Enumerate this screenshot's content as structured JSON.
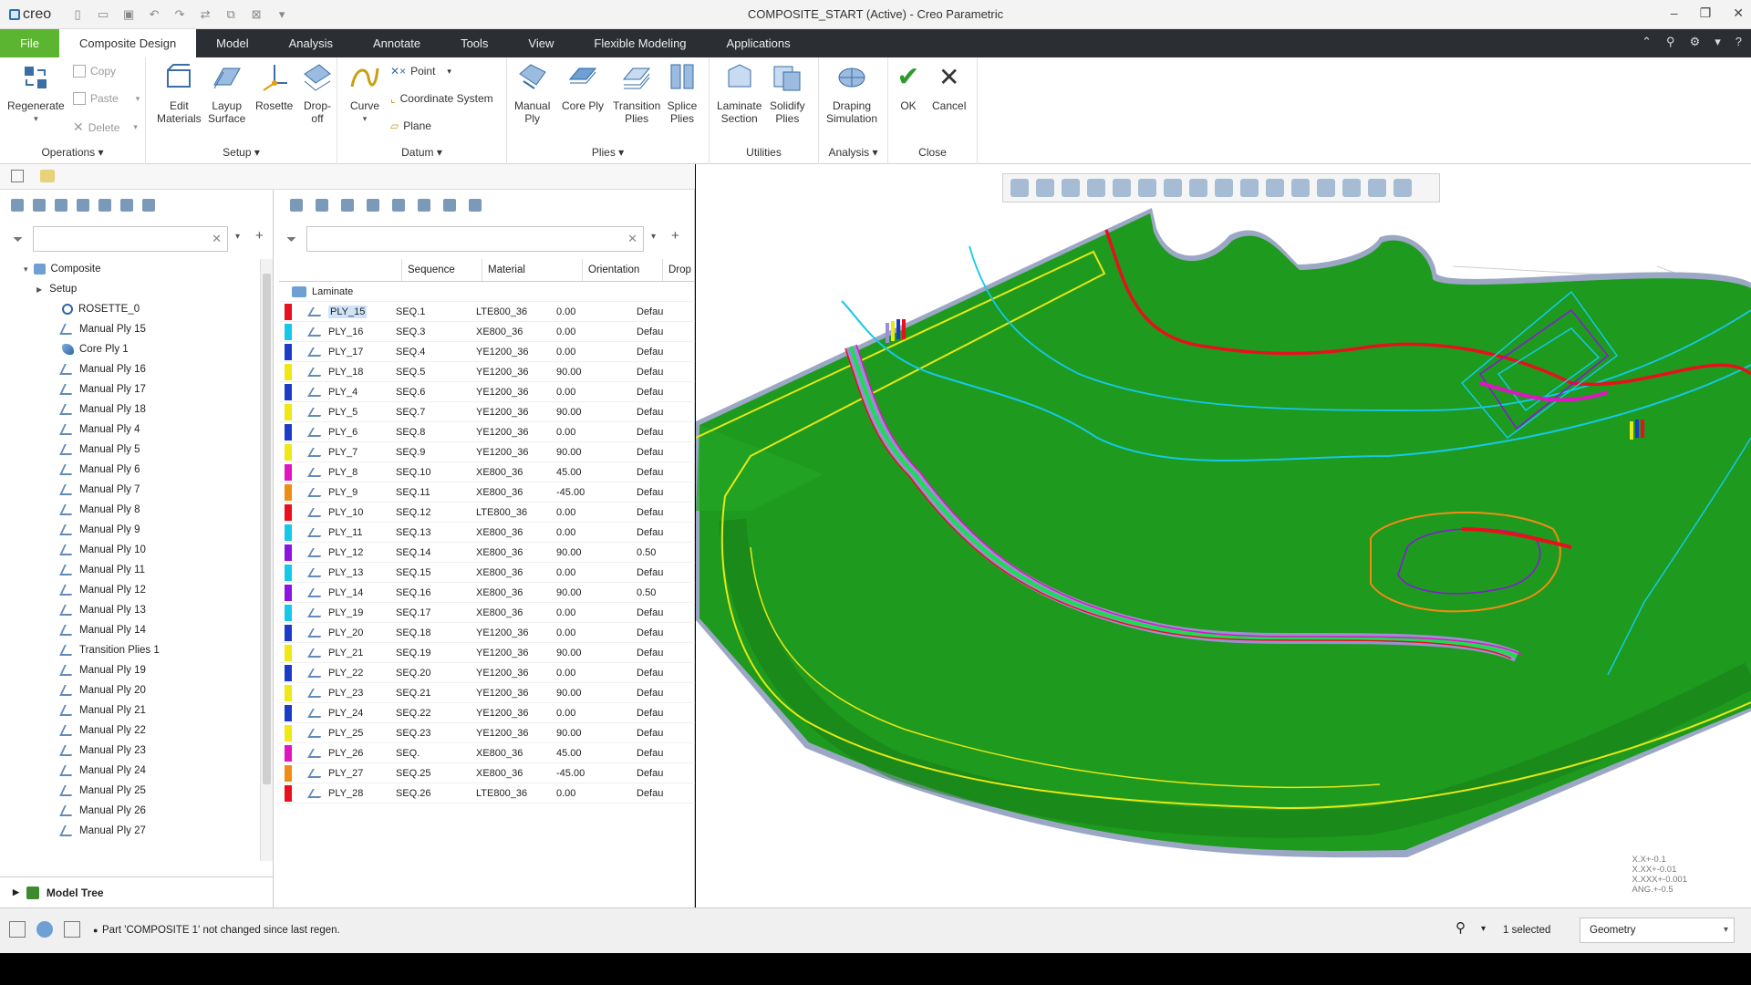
{
  "window": {
    "logo": "creo",
    "title": "COMPOSITE_START (Active) - Creo Parametric"
  },
  "ribbon_tabs": [
    "File",
    "Composite Design",
    "Model",
    "Analysis",
    "Annotate",
    "Tools",
    "View",
    "Flexible Modeling",
    "Applications"
  ],
  "groups": {
    "operations": {
      "label": "Operations",
      "regenerate": "Regenerate",
      "copy": "Copy",
      "paste": "Paste",
      "delete": "Delete"
    },
    "setup": {
      "label": "Setup",
      "edit_materials": "Edit\nMaterials",
      "layup_surface": "Layup\nSurface",
      "rosette": "Rosette",
      "dropoff": "Drop-\noff"
    },
    "datum": {
      "label": "Datum",
      "curve": "Curve",
      "point": "Point",
      "coordinate_system": "Coordinate System",
      "plane": "Plane"
    },
    "plies": {
      "label": "Plies",
      "manual_ply": "Manual\nPly",
      "core_ply": "Core Ply",
      "transition_plies": "Transition\nPlies",
      "splice_plies": "Splice\nPlies"
    },
    "utilities": {
      "label": "Utilities",
      "laminate_section": "Laminate\nSection",
      "solidify_plies": "Solidify\nPlies"
    },
    "analysis": {
      "label": "Analysis",
      "draping_simulation": "Draping\nSimulation"
    },
    "close": {
      "label": "Close",
      "ok": "OK",
      "cancel": "Cancel"
    }
  },
  "tree": {
    "items": [
      {
        "label": "Composite",
        "type": "comp",
        "indent": 0
      },
      {
        "label": "Setup",
        "type": "none",
        "indent": 1
      },
      {
        "label": "ROSETTE_0",
        "type": "ros",
        "indent": 2
      },
      {
        "label": "Manual Ply 15",
        "type": "ply",
        "indent": 2
      },
      {
        "label": "Core Ply 1",
        "type": "core",
        "indent": 2
      },
      {
        "label": "Manual Ply 16",
        "type": "ply",
        "indent": 2
      },
      {
        "label": "Manual Ply 17",
        "type": "ply",
        "indent": 2
      },
      {
        "label": "Manual Ply 18",
        "type": "ply",
        "indent": 2
      },
      {
        "label": "Manual Ply 4",
        "type": "ply",
        "indent": 2
      },
      {
        "label": "Manual Ply 5",
        "type": "ply",
        "indent": 2
      },
      {
        "label": "Manual Ply 6",
        "type": "ply",
        "indent": 2
      },
      {
        "label": "Manual Ply 7",
        "type": "ply",
        "indent": 2
      },
      {
        "label": "Manual Ply 8",
        "type": "ply",
        "indent": 2
      },
      {
        "label": "Manual Ply 9",
        "type": "ply",
        "indent": 2
      },
      {
        "label": "Manual Ply 10",
        "type": "ply",
        "indent": 2
      },
      {
        "label": "Manual Ply 11",
        "type": "ply",
        "indent": 2
      },
      {
        "label": "Manual Ply 12",
        "type": "ply",
        "indent": 2
      },
      {
        "label": "Manual Ply 13",
        "type": "ply",
        "indent": 2
      },
      {
        "label": "Manual Ply 14",
        "type": "ply",
        "indent": 2
      },
      {
        "label": "Transition Plies 1",
        "type": "ply",
        "indent": 2
      },
      {
        "label": "Manual Ply 19",
        "type": "ply",
        "indent": 2
      },
      {
        "label": "Manual Ply 20",
        "type": "ply",
        "indent": 2
      },
      {
        "label": "Manual Ply 21",
        "type": "ply",
        "indent": 2
      },
      {
        "label": "Manual Ply 22",
        "type": "ply",
        "indent": 2
      },
      {
        "label": "Manual Ply 23",
        "type": "ply",
        "indent": 2
      },
      {
        "label": "Manual Ply 24",
        "type": "ply",
        "indent": 2
      },
      {
        "label": "Manual Ply 25",
        "type": "ply",
        "indent": 2
      },
      {
        "label": "Manual Ply 26",
        "type": "ply",
        "indent": 2
      },
      {
        "label": "Manual Ply 27",
        "type": "ply",
        "indent": 2
      }
    ],
    "model_tree_label": "Model Tree"
  },
  "table": {
    "root_label": "Laminate",
    "columns": [
      "Sequence",
      "Material",
      "Orientation",
      "Drop"
    ],
    "rows": [
      {
        "ply": "PLY_15",
        "seq": "SEQ.1",
        "mat": "LTE800_36",
        "ori": "0.00",
        "drop": "Defau",
        "color": "#e8101c"
      },
      {
        "ply": "PLY_16",
        "seq": "SEQ.3",
        "mat": "XE800_36",
        "ori": "0.00",
        "drop": "Defau",
        "color": "#16c8e8"
      },
      {
        "ply": "PLY_17",
        "seq": "SEQ.4",
        "mat": "YE1200_36",
        "ori": "0.00",
        "drop": "Defau",
        "color": "#1c3cc8"
      },
      {
        "ply": "PLY_18",
        "seq": "SEQ.5",
        "mat": "YE1200_36",
        "ori": "90.00",
        "drop": "Defau",
        "color": "#f0e814"
      },
      {
        "ply": "PLY_4",
        "seq": "SEQ.6",
        "mat": "YE1200_36",
        "ori": "0.00",
        "drop": "Defau",
        "color": "#1c3cc8"
      },
      {
        "ply": "PLY_5",
        "seq": "SEQ.7",
        "mat": "YE1200_36",
        "ori": "90.00",
        "drop": "Defau",
        "color": "#f0e814"
      },
      {
        "ply": "PLY_6",
        "seq": "SEQ.8",
        "mat": "YE1200_36",
        "ori": "0.00",
        "drop": "Defau",
        "color": "#1c3cc8"
      },
      {
        "ply": "PLY_7",
        "seq": "SEQ.9",
        "mat": "YE1200_36",
        "ori": "90.00",
        "drop": "Defau",
        "color": "#f0e814"
      },
      {
        "ply": "PLY_8",
        "seq": "SEQ.10",
        "mat": "XE800_36",
        "ori": "45.00",
        "drop": "Defau",
        "color": "#e014c0"
      },
      {
        "ply": "PLY_9",
        "seq": "SEQ.11",
        "mat": "XE800_36",
        "ori": "-45.00",
        "drop": "Defau",
        "color": "#f08c14"
      },
      {
        "ply": "PLY_10",
        "seq": "SEQ.12",
        "mat": "LTE800_36",
        "ori": "0.00",
        "drop": "Defau",
        "color": "#e8101c"
      },
      {
        "ply": "PLY_11",
        "seq": "SEQ.13",
        "mat": "XE800_36",
        "ori": "0.00",
        "drop": "Defau",
        "color": "#16c8e8"
      },
      {
        "ply": "PLY_12",
        "seq": "SEQ.14",
        "mat": "XE800_36",
        "ori": "90.00",
        "drop": "0.50",
        "color": "#8c14e0"
      },
      {
        "ply": "PLY_13",
        "seq": "SEQ.15",
        "mat": "XE800_36",
        "ori": "0.00",
        "drop": "Defau",
        "color": "#16c8e8"
      },
      {
        "ply": "PLY_14",
        "seq": "SEQ.16",
        "mat": "XE800_36",
        "ori": "90.00",
        "drop": "0.50",
        "color": "#8c14e0"
      },
      {
        "ply": "PLY_19",
        "seq": "SEQ.17",
        "mat": "XE800_36",
        "ori": "0.00",
        "drop": "Defau",
        "color": "#16c8e8"
      },
      {
        "ply": "PLY_20",
        "seq": "SEQ.18",
        "mat": "YE1200_36",
        "ori": "0.00",
        "drop": "Defau",
        "color": "#1c3cc8"
      },
      {
        "ply": "PLY_21",
        "seq": "SEQ.19",
        "mat": "YE1200_36",
        "ori": "90.00",
        "drop": "Defau",
        "color": "#f0e814"
      },
      {
        "ply": "PLY_22",
        "seq": "SEQ.20",
        "mat": "YE1200_36",
        "ori": "0.00",
        "drop": "Defau",
        "color": "#1c3cc8"
      },
      {
        "ply": "PLY_23",
        "seq": "SEQ.21",
        "mat": "YE1200_36",
        "ori": "90.00",
        "drop": "Defau",
        "color": "#f0e814"
      },
      {
        "ply": "PLY_24",
        "seq": "SEQ.22",
        "mat": "YE1200_36",
        "ori": "0.00",
        "drop": "Defau",
        "color": "#1c3cc8"
      },
      {
        "ply": "PLY_25",
        "seq": "SEQ.23",
        "mat": "YE1200_36",
        "ori": "90.00",
        "drop": "Defau",
        "color": "#f0e814"
      },
      {
        "ply": "PLY_26",
        "seq": "SEQ.",
        "mat": "XE800_36",
        "ori": "45.00",
        "drop": "Defau",
        "color": "#e014c0"
      },
      {
        "ply": "PLY_27",
        "seq": "SEQ.25",
        "mat": "XE800_36",
        "ori": "-45.00",
        "drop": "Defau",
        "color": "#f08c14"
      },
      {
        "ply": "PLY_28",
        "seq": "SEQ.26",
        "mat": "LTE800_36",
        "ori": "0.00",
        "drop": "Defau",
        "color": "#e8101c"
      }
    ]
  },
  "viewport": {
    "tolerances": [
      "X.X+-0.1",
      "X.XX+-0.01",
      "X.XXX+-0.001",
      "ANG.+-0.5"
    ]
  },
  "status": {
    "message": "Part 'COMPOSITE 1' not changed since last regen.",
    "selected": "1 selected",
    "filter_value": "Geometry"
  }
}
